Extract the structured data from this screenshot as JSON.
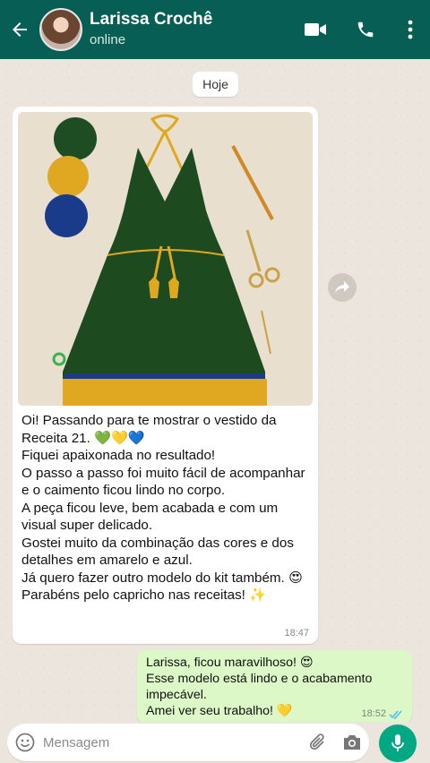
{
  "header": {
    "contact_name": "Larissa Crochê",
    "status": "online",
    "icons": [
      "back-arrow-icon",
      "video-call-icon",
      "phone-icon",
      "more-vert-icon"
    ]
  },
  "chat": {
    "date_label": "Hoje",
    "incoming": {
      "image": "crochet-dress-photo",
      "text": "Oi! Passando para te mostrar o vestido da Receita 21. 💚💛💙\nFiquei apaixonada no resultado!\nO passo a passo foi muito fácil de acompanhar e o caimento ficou lindo no corpo.\nA peça ficou leve, bem acabada e com um visual super delicado.\nGostei muito da combinação das cores e dos detalhes em amarelo e azul.\nJá quero fazer outro modelo do kit também. 😍\nParabéns pelo capricho nas receitas! ✨",
      "time": "18:47"
    },
    "outgoing": {
      "text": "Larissa, ficou maravilhoso! 😍\nEsse modelo está lindo e o acabamento impecável.\nAmei ver seu trabalho! 💛",
      "time": "18:52",
      "status_icon": "double-check-read-icon"
    }
  },
  "input": {
    "placeholder": "Mensagem",
    "icons": [
      "emoji-icon",
      "attach-icon",
      "camera-icon",
      "mic-icon"
    ]
  },
  "colors": {
    "header": "#075e54",
    "outgoing_bubble": "#dcf8c6",
    "mic_button": "#00a884",
    "read_check": "#53bdeb"
  }
}
